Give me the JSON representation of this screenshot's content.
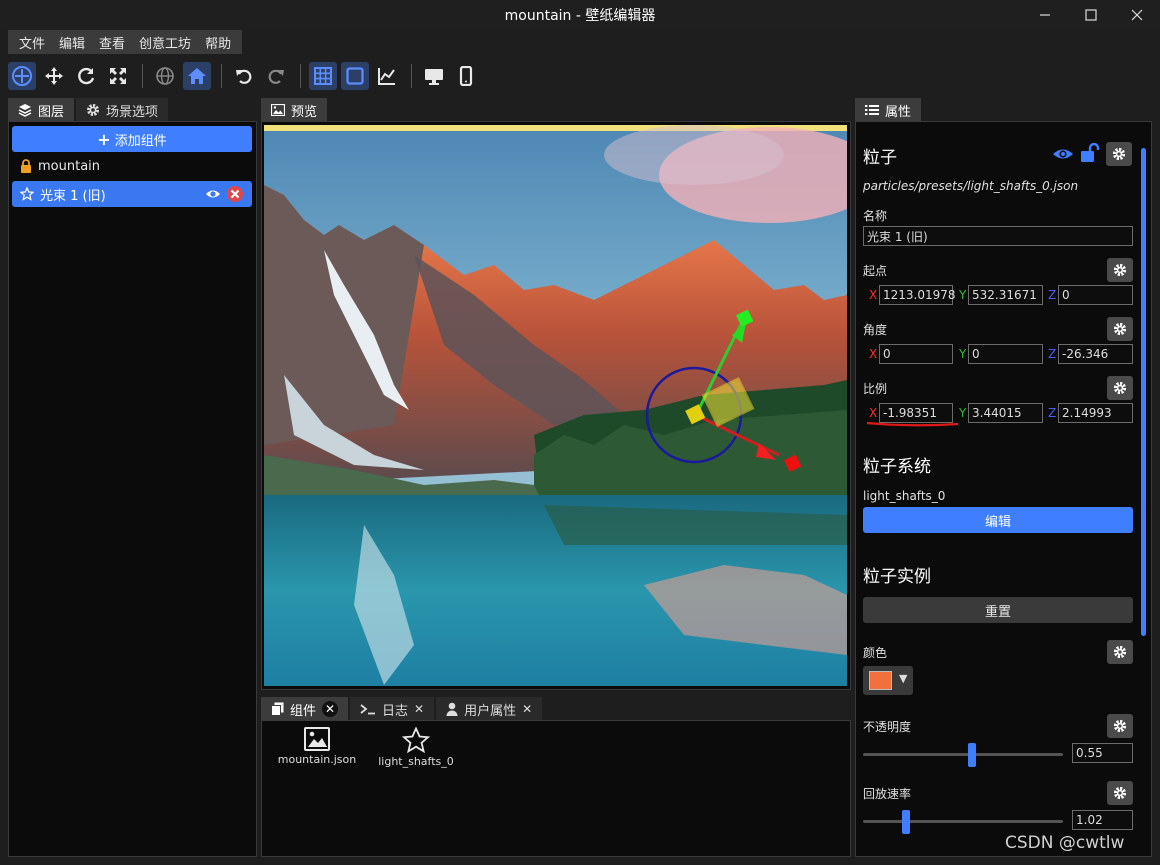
{
  "window": {
    "title": "mountain - 壁纸编辑器"
  },
  "menu": [
    "文件",
    "编辑",
    "查看",
    "创意工坊",
    "帮助"
  ],
  "left_panel": {
    "tabs": [
      "图层",
      "场景选项"
    ],
    "add_button": "添加组件",
    "layers": [
      {
        "label": "mountain"
      },
      {
        "label": "光束 1 (旧)"
      }
    ]
  },
  "preview": {
    "tab": "预览"
  },
  "bottom_panel": {
    "tabs": [
      "组件",
      "日志",
      "用户属性"
    ],
    "assets": [
      {
        "label": "mountain.json"
      },
      {
        "label": "light_shafts_0"
      }
    ]
  },
  "properties": {
    "tab": "属性",
    "heading": "粒子",
    "path": "particles/presets/light_shafts_0.json",
    "name_label": "名称",
    "name_value": "光束 1 (旧)",
    "origin_label": "起点",
    "origin": {
      "x": "1213.01978",
      "y": "532.31671",
      "z": "0"
    },
    "angle_label": "角度",
    "angle": {
      "x": "0",
      "y": "0",
      "z": "-26.346"
    },
    "scale_label": "比例",
    "scale": {
      "x": "-1.98351",
      "y": "3.44015",
      "z": "2.14993"
    },
    "system_heading": "粒子系统",
    "system_value": "light_shafts_0",
    "edit_button": "编辑",
    "instance_heading": "粒子实例",
    "reset_button": "重置",
    "color_label": "颜色",
    "color_value": "#f2703c",
    "opacity_label": "不透明度",
    "opacity_value": "0.55",
    "playback_label": "回放速率",
    "playback_value": "1.02",
    "axis_labels": {
      "x": "X",
      "y": "Y",
      "z": "Z"
    }
  },
  "watermark": "CSDN @cwtlw",
  "colors": {
    "accent": "#3f7fff",
    "axis_x": "#ff3030",
    "axis_y": "#30c030",
    "axis_z": "#4a5cff"
  }
}
